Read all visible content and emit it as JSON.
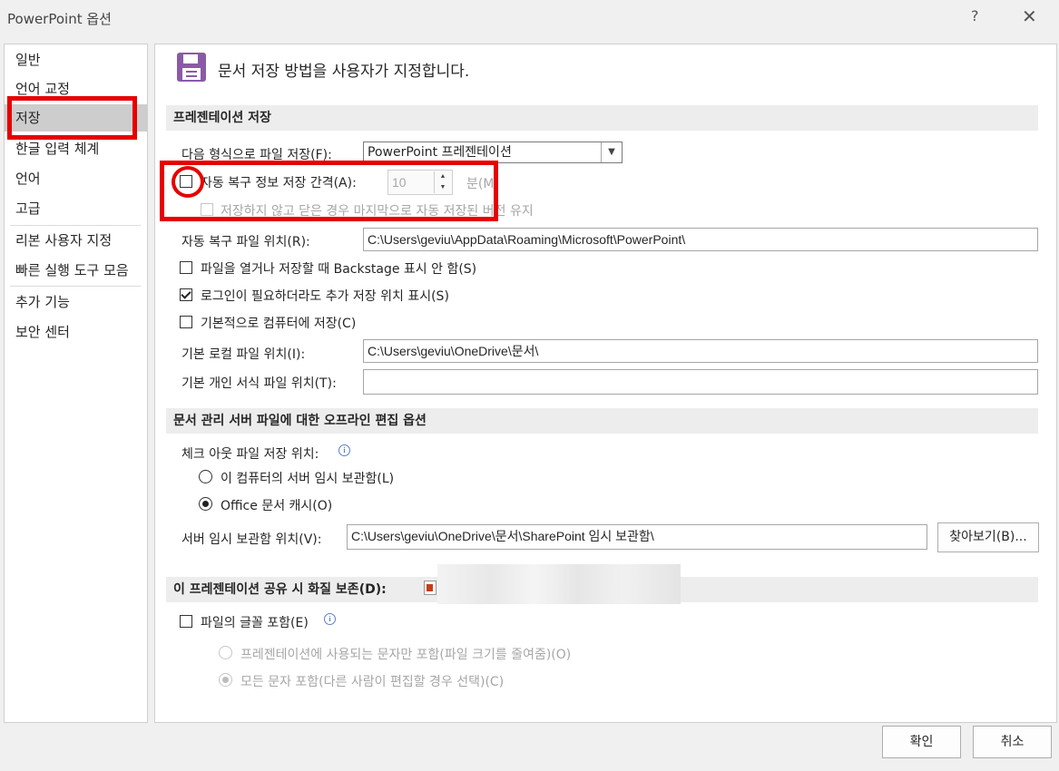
{
  "window": {
    "title": "PowerPoint 옵션",
    "help": "?",
    "close": "✕"
  },
  "nav": {
    "items": [
      {
        "label": "일반"
      },
      {
        "label": "언어 교정"
      },
      {
        "label": "저장"
      },
      {
        "label": "한글 입력 체계"
      },
      {
        "label": "언어"
      },
      {
        "label": "고급"
      },
      {
        "label": "리본 사용자 지정"
      },
      {
        "label": "빠른 실행 도구 모음"
      },
      {
        "label": "추가 기능"
      },
      {
        "label": "보안 센터"
      }
    ],
    "selected_index": 2
  },
  "header": {
    "title": "문서 저장 방법을 사용자가 지정합니다.",
    "icon": "save-icon"
  },
  "section1": {
    "title": "프레젠테이션 저장",
    "format_label": "다음 형식으로 파일 저장(F):",
    "format_value": "PowerPoint 프레젠테이션",
    "autorecover_label": "자동 복구 정보 저장 간격(A):",
    "autorecover_checked": false,
    "autorecover_minutes": "10",
    "minutes_label": "분(M)",
    "keep_last_label": "저장하지 않고 닫은 경우 마지막으로 자동 저장된 버전 유지",
    "autorecover_path_label": "자동 복구 파일 위치(R):",
    "autorecover_path_value": "C:\\Users\\geviu\\AppData\\Roaming\\Microsoft\\PowerPoint\\",
    "no_backstage_label": "파일을 열거나 저장할 때 Backstage 표시 안 함(S)",
    "no_backstage_checked": false,
    "show_locations_label": "로그인이 필요하더라도 추가 저장 위치 표시(S)",
    "show_locations_checked": true,
    "save_to_computer_label": "기본적으로 컴퓨터에 저장(C)",
    "save_to_computer_checked": false,
    "local_path_label": "기본 로컬 파일 위치(I):",
    "local_path_value": "C:\\Users\\geviu\\OneDrive\\문서\\",
    "template_path_label": "기본 개인 서식 파일 위치(T):",
    "template_path_value": ""
  },
  "section2": {
    "title": "문서 관리 서버 파일에 대한 오프라인 편집 옵션",
    "checkout_label": "체크 아웃 파일 저장 위치:",
    "radio_server_drafts": "이 컴퓨터의 서버 임시 보관함(L)",
    "radio_office_cache": "Office 문서 캐시(O)",
    "selected_option": "office_cache",
    "drafts_location_label": "서버 임시 보관함 위치(V):",
    "drafts_location_value": "C:\\Users\\geviu\\OneDrive\\문서\\SharePoint 임시 보관함\\",
    "browse_button": "찾아보기(B)..."
  },
  "section3": {
    "title": "이 프레젠테이션 공유 시 화질 보존(D):",
    "embed_fonts_label": "파일의 글꼴 포함(E)",
    "embed_fonts_checked": false,
    "radio_used_chars": "프레젠테이션에 사용되는 문자만 포함(파일 크기를 줄여줌)(O)",
    "radio_all_chars": "모든 문자 포함(다른 사람이 편집할 경우 선택)(C)",
    "embed_selected": "all_chars"
  },
  "footer": {
    "ok": "확인",
    "cancel": "취소"
  },
  "annotation_color": "#e60000",
  "accent_color": "#8a5aa8"
}
